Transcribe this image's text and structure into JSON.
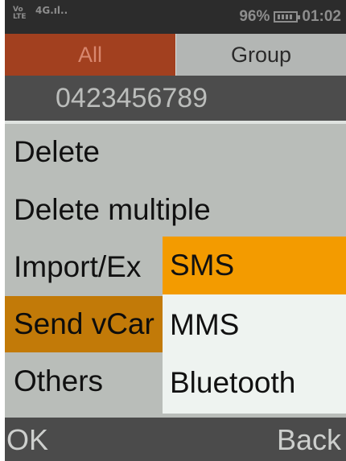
{
  "status_bar": {
    "volte_top": "Vo",
    "volte_bottom": "LTE",
    "network": "4G",
    "battery_percent": "96%",
    "time": "01:02"
  },
  "tabs": [
    {
      "label": "All",
      "selected": true
    },
    {
      "label": "Group",
      "selected": false
    }
  ],
  "contact_number": "0423456789",
  "menu": {
    "items": [
      {
        "label": "Delete"
      },
      {
        "label": "Delete multiple"
      },
      {
        "label": "Import/Ex"
      },
      {
        "label": "Send vCar",
        "selected": true
      },
      {
        "label": "Others"
      }
    ]
  },
  "submenu": {
    "items": [
      {
        "label": "SMS",
        "selected": true
      },
      {
        "label": "MMS"
      },
      {
        "label": "Bluetooth"
      }
    ]
  },
  "softkeys": {
    "left": "OK",
    "right": "Back"
  },
  "colors": {
    "tab_active": "#a2401f",
    "menu_selected": "#c27a08",
    "submenu_selected": "#f39b00"
  }
}
